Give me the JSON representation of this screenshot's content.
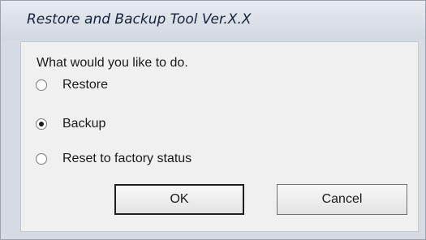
{
  "window": {
    "title": "Restore and Backup Tool Ver.X.X"
  },
  "dialog": {
    "prompt": "What would you like to do.",
    "options": [
      {
        "label": "Restore",
        "selected": false
      },
      {
        "label": "Backup",
        "selected": true
      },
      {
        "label": "Reset to factory status",
        "selected": false
      }
    ],
    "buttons": {
      "ok_label": "OK",
      "cancel_label": "Cancel"
    }
  },
  "colors": {
    "frame": "#d6dbe3",
    "client_background": "#f0f0f0",
    "title_text": "#15223a"
  }
}
